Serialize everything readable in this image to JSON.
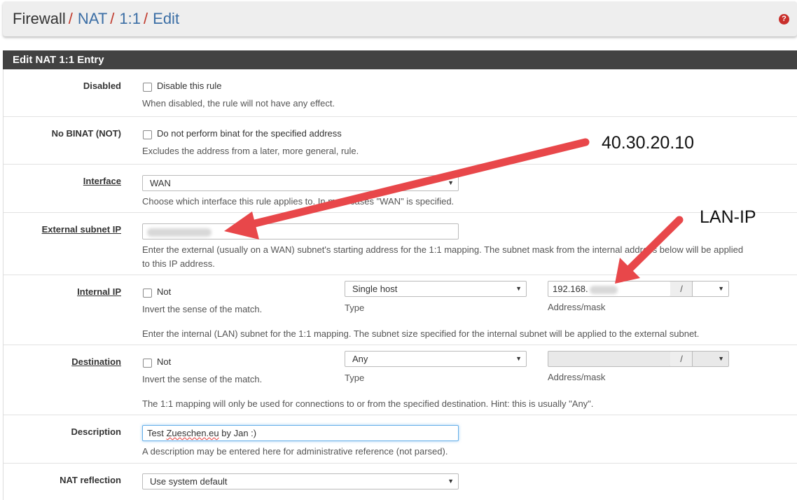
{
  "breadcrumb": [
    "Firewall",
    "NAT",
    "1:1",
    "Edit"
  ],
  "help_icon_glyph": "?",
  "panel_title": "Edit NAT 1:1 Entry",
  "disabled": {
    "label": "Disabled",
    "checkbox_label": "Disable this rule",
    "help": "When disabled, the rule will not have any effect."
  },
  "nobinat": {
    "label": "No BINAT (NOT)",
    "checkbox_label": "Do not perform binat for the specified address",
    "help": "Excludes the address from a later, more general, rule."
  },
  "interface": {
    "label": "Interface",
    "value": "WAN",
    "help": "Choose which interface this rule applies to. In most cases \"WAN\" is specified."
  },
  "external": {
    "label": "External subnet IP",
    "help_line1": "Enter the external (usually on a WAN) subnet's starting address for the 1:1 mapping. The subnet mask from the internal address below will be applied",
    "help_line2": "to this IP address."
  },
  "internal": {
    "label": "Internal IP",
    "not_label": "Not",
    "invert_help": "Invert the sense of the match.",
    "type_value": "Single host",
    "type_label": "Type",
    "address_prefix": "192.168.",
    "slash": "/",
    "address_label": "Address/mask",
    "help": "Enter the internal (LAN) subnet for the 1:1 mapping. The subnet size specified for the internal subnet will be applied to the external subnet."
  },
  "destination": {
    "label": "Destination",
    "not_label": "Not",
    "invert_help": "Invert the sense of the match.",
    "type_value": "Any",
    "type_label": "Type",
    "slash": "/",
    "address_label": "Address/mask",
    "help": "The 1:1 mapping will only be used for connections to or from the specified destination. Hint: this is usually \"Any\"."
  },
  "description": {
    "label": "Description",
    "value_prefix": "Test ",
    "value_spell": "Zueschen.eu",
    "value_suffix": " by Jan :)",
    "help": "A description may be entered here for administrative reference (not parsed)."
  },
  "nat_reflection": {
    "label": "NAT reflection",
    "value": "Use system default"
  },
  "annotations": {
    "external_ip": "40.30.20.10",
    "lan_ip": "LAN-IP",
    "arrow_color": "#e8474a"
  }
}
